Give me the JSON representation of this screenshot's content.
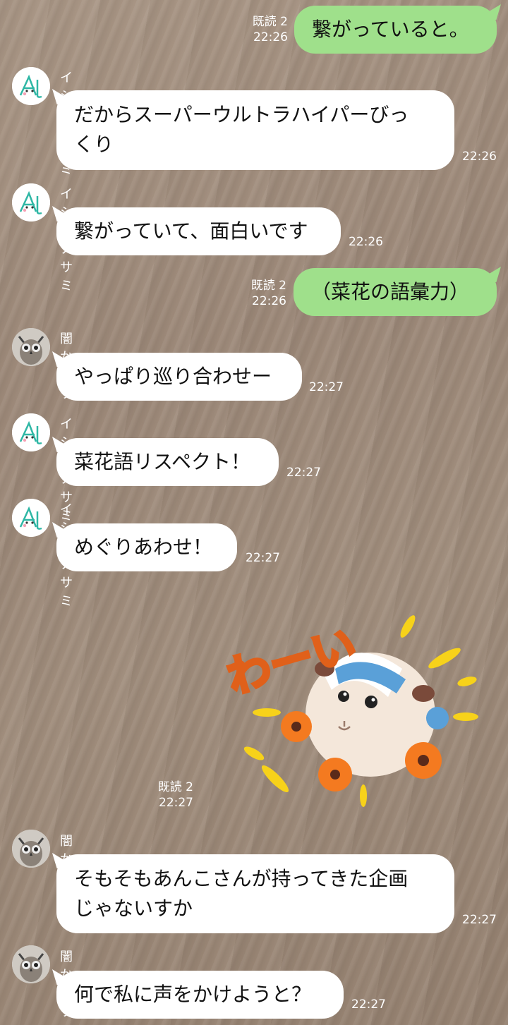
{
  "messages": [
    {
      "kind": "out",
      "text": "繋がっていると。",
      "read": "既読 2",
      "time": "22:26"
    },
    {
      "kind": "in",
      "sender": "イシノアサミ",
      "avatar": "asami-avatar",
      "text": "だからスーパーウルトラハイパーびっ\nくり",
      "time": "22:26"
    },
    {
      "kind": "in",
      "sender": "イシノアサミ",
      "avatar": "asami-avatar",
      "text": "繋がっていて、面白いです",
      "time": "22:26"
    },
    {
      "kind": "out",
      "text": "（菜花の語彙力）",
      "read": "既読 2",
      "time": "22:26"
    },
    {
      "kind": "in",
      "sender": "闇からす",
      "avatar": "owl-avatar",
      "text": "やっぱり巡り合わせー",
      "time": "22:27"
    },
    {
      "kind": "in",
      "sender": "イシノアサミ",
      "avatar": "asami-avatar",
      "text": "菜花語リスペクト！",
      "time": "22:27"
    },
    {
      "kind": "in",
      "sender": "イシノアサミ",
      "avatar": "asami-avatar",
      "text": "めぐりあわせ！",
      "time": "22:27"
    },
    {
      "kind": "sticker",
      "sticker_text": "わーい",
      "read": "既読 2",
      "time": "22:27",
      "icon": "guinea-pig-sticker"
    },
    {
      "kind": "in",
      "sender": "闇からす",
      "avatar": "owl-avatar",
      "text": "そもそもあんこさんが持ってきた企画\nじゃないすか",
      "time": "22:27"
    },
    {
      "kind": "in",
      "sender": "闇からす",
      "avatar": "owl-avatar",
      "text": "何で私に声をかけようと？",
      "time": "22:27"
    }
  ],
  "colors": {
    "outgoing_bubble": "#9fe08b",
    "incoming_bubble": "#ffffff",
    "background": "#a08d7c"
  }
}
